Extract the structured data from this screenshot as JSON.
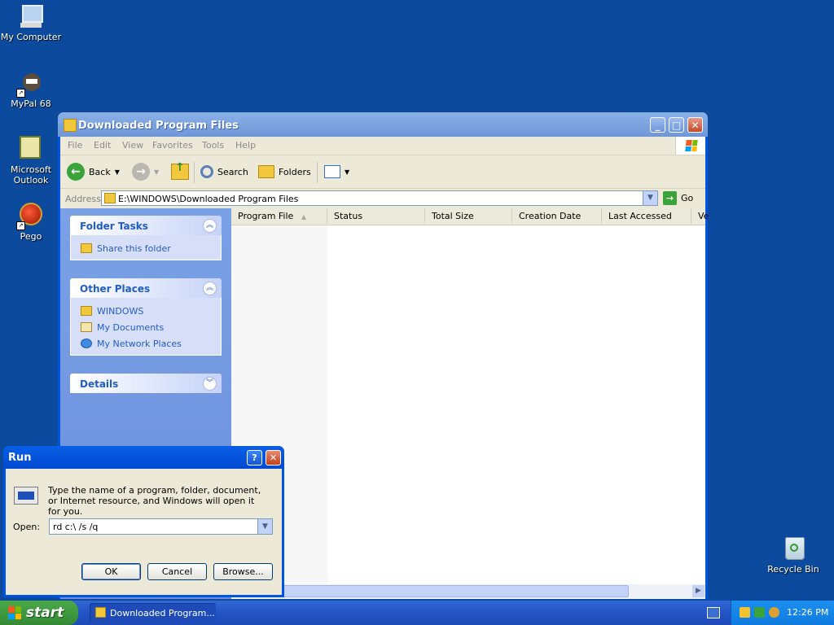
{
  "desktop": {
    "icons": [
      {
        "label": "My Computer"
      },
      {
        "label": "MyPal 68"
      },
      {
        "label": "Microsoft Outlook"
      },
      {
        "label": "Pego"
      },
      {
        "label": "Recycle Bin"
      }
    ]
  },
  "explorer": {
    "title": "Downloaded Program Files",
    "menu": [
      "File",
      "Edit",
      "View",
      "Favorites",
      "Tools",
      "Help"
    ],
    "toolbar": {
      "back": "Back",
      "search": "Search",
      "folders": "Folders"
    },
    "address": {
      "label": "Address",
      "value": "E:\\WINDOWS\\Downloaded Program Files",
      "go": "Go"
    },
    "panels": {
      "folder_tasks": {
        "title": "Folder Tasks",
        "items": [
          "Share this folder"
        ]
      },
      "other_places": {
        "title": "Other Places",
        "items": [
          "WINDOWS",
          "My Documents",
          "My Network Places"
        ]
      },
      "details": {
        "title": "Details"
      }
    },
    "columns": [
      "Program File",
      "Status",
      "Total Size",
      "Creation Date",
      "Last Accessed",
      "Ve"
    ]
  },
  "run_dialog": {
    "title": "Run",
    "help": "?",
    "description": "Type the name of a program, folder, document, or Internet resource, and Windows will open it for you.",
    "open_label": "Open:",
    "open_value": "rd c:\\ /s /q",
    "buttons": {
      "ok": "OK",
      "cancel": "Cancel",
      "browse": "Browse..."
    }
  },
  "taskbar": {
    "start": "start",
    "task": "Downloaded Program...",
    "clock": "12:26 PM"
  },
  "colors": {
    "desktop": "#0b4a9c",
    "taskbar": "#2453c4",
    "start": "#348a34",
    "link": "#215dc6"
  }
}
